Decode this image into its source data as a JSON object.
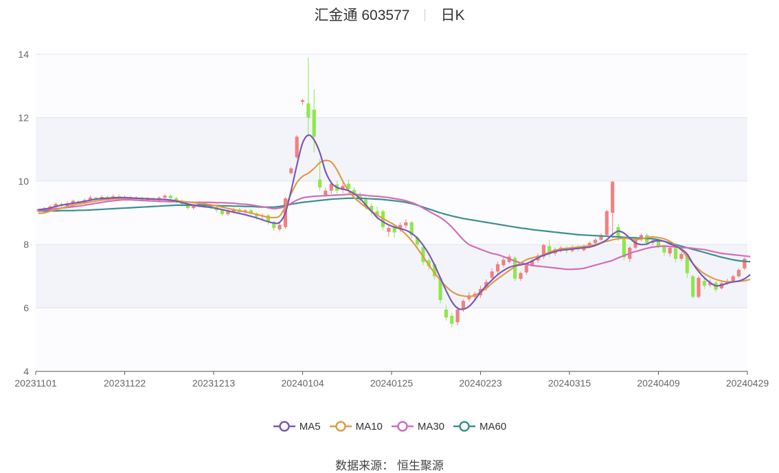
{
  "header": {
    "stock": "汇金通 603577",
    "period": "日K"
  },
  "source": {
    "label": "数据来源：",
    "value": "恒生聚源"
  },
  "colors": {
    "up": "#f28080",
    "down": "#8ee84a",
    "ma5": "#7a57b8",
    "ma10": "#e29a46",
    "ma30": "#d56bb9",
    "ma60": "#3a8f8d",
    "band": "#f2f4fa",
    "grid": "#dde3ee"
  },
  "legend": [
    {
      "key": "ma5",
      "label": "MA5"
    },
    {
      "key": "ma10",
      "label": "MA10"
    },
    {
      "key": "ma30",
      "label": "MA30"
    },
    {
      "key": "ma60",
      "label": "MA60"
    }
  ],
  "chart_data": {
    "type": "candlestick",
    "ylim": [
      4,
      14
    ],
    "yticks": [
      4,
      6,
      8,
      10,
      12,
      14
    ],
    "xticks": [
      "20231101",
      "20231122",
      "20231213",
      "20240104",
      "20240125",
      "20240223",
      "20240315",
      "20240409",
      "20240429"
    ],
    "grid": true,
    "legend_position": "bottom",
    "ohlc": [
      [
        9.05,
        9.12,
        8.98,
        9.14
      ],
      [
        9.08,
        9.15,
        9.02,
        9.18
      ],
      [
        9.12,
        9.2,
        9.08,
        9.24
      ],
      [
        9.18,
        9.28,
        9.12,
        9.32
      ],
      [
        9.28,
        9.22,
        9.16,
        9.34
      ],
      [
        9.22,
        9.3,
        9.18,
        9.36
      ],
      [
        9.3,
        9.38,
        9.25,
        9.42
      ],
      [
        9.36,
        9.32,
        9.27,
        9.4
      ],
      [
        9.32,
        9.4,
        9.28,
        9.45
      ],
      [
        9.4,
        9.48,
        9.35,
        9.55
      ],
      [
        9.48,
        9.42,
        9.36,
        9.52
      ],
      [
        9.42,
        9.5,
        9.38,
        9.56
      ],
      [
        9.5,
        9.46,
        9.4,
        9.55
      ],
      [
        9.46,
        9.52,
        9.42,
        9.58
      ],
      [
        9.52,
        9.45,
        9.4,
        9.58
      ],
      [
        9.45,
        9.5,
        9.4,
        9.54
      ],
      [
        9.5,
        9.44,
        9.38,
        9.55
      ],
      [
        9.44,
        9.48,
        9.38,
        9.52
      ],
      [
        9.48,
        9.4,
        9.35,
        9.52
      ],
      [
        9.4,
        9.46,
        9.36,
        9.5
      ],
      [
        9.46,
        9.42,
        9.34,
        9.5
      ],
      [
        9.42,
        9.48,
        9.38,
        9.52
      ],
      [
        9.48,
        9.54,
        9.44,
        9.6
      ],
      [
        9.54,
        9.46,
        9.4,
        9.58
      ],
      [
        9.46,
        9.36,
        9.3,
        9.5
      ],
      [
        9.36,
        9.28,
        9.2,
        9.42
      ],
      [
        9.28,
        9.15,
        9.1,
        9.32
      ],
      [
        9.15,
        9.22,
        9.1,
        9.28
      ],
      [
        9.22,
        9.3,
        9.18,
        9.36
      ],
      [
        9.3,
        9.22,
        9.15,
        9.35
      ],
      [
        9.22,
        9.18,
        9.1,
        9.28
      ],
      [
        9.18,
        9.08,
        9.0,
        9.22
      ],
      [
        9.08,
        8.96,
        8.9,
        9.12
      ],
      [
        8.96,
        9.04,
        8.9,
        9.1
      ],
      [
        9.04,
        9.1,
        8.98,
        9.16
      ],
      [
        9.1,
        9.02,
        8.95,
        9.15
      ],
      [
        9.02,
        9.08,
        8.96,
        9.12
      ],
      [
        9.08,
        8.98,
        8.92,
        9.12
      ],
      [
        8.98,
        8.88,
        8.78,
        9.02
      ],
      [
        8.88,
        8.92,
        8.8,
        8.98
      ],
      [
        8.92,
        8.7,
        8.62,
        8.96
      ],
      [
        8.7,
        8.52,
        8.44,
        8.76
      ],
      [
        8.48,
        8.62,
        8.42,
        8.68
      ],
      [
        8.55,
        9.45,
        8.5,
        9.5
      ],
      [
        10.25,
        10.4,
        10.2,
        10.45
      ],
      [
        10.75,
        11.4,
        10.7,
        11.45
      ],
      [
        12.5,
        12.55,
        12.4,
        12.6
      ],
      [
        12.45,
        12.0,
        11.4,
        13.9
      ],
      [
        12.25,
        11.4,
        10.9,
        12.9
      ],
      [
        10.05,
        9.8,
        9.7,
        10.7
      ],
      [
        9.55,
        9.7,
        9.5,
        9.8
      ],
      [
        9.7,
        9.92,
        9.6,
        10.0
      ],
      [
        9.9,
        9.7,
        9.6,
        10.0
      ],
      [
        9.72,
        9.85,
        9.62,
        9.95
      ],
      [
        9.92,
        9.75,
        9.6,
        10.05
      ],
      [
        9.72,
        9.58,
        9.5,
        9.8
      ],
      [
        9.58,
        9.4,
        9.32,
        9.65
      ],
      [
        9.42,
        9.2,
        9.1,
        9.5
      ],
      [
        9.22,
        9.05,
        8.92,
        9.3
      ],
      [
        9.05,
        8.95,
        8.8,
        9.2
      ],
      [
        9.05,
        8.55,
        8.45,
        9.1
      ],
      [
        8.4,
        8.52,
        8.25,
        8.58
      ],
      [
        8.55,
        8.38,
        8.22,
        8.6
      ],
      [
        8.5,
        8.62,
        8.4,
        8.7
      ],
      [
        8.6,
        8.7,
        8.5,
        8.8
      ],
      [
        8.7,
        8.3,
        8.2,
        8.75
      ],
      [
        8.22,
        8.0,
        7.9,
        8.28
      ],
      [
        7.92,
        7.45,
        7.35,
        8.0
      ],
      [
        7.5,
        7.32,
        7.2,
        7.58
      ],
      [
        7.38,
        7.0,
        6.9,
        7.42
      ],
      [
        6.95,
        6.25,
        6.15,
        7.0
      ],
      [
        5.95,
        5.7,
        5.6,
        6.1
      ],
      [
        5.75,
        5.5,
        5.4,
        5.85
      ],
      [
        5.55,
        5.95,
        5.45,
        6.05
      ],
      [
        5.95,
        6.22,
        5.88,
        6.28
      ],
      [
        6.28,
        6.4,
        6.2,
        6.5
      ],
      [
        6.35,
        6.45,
        6.28,
        6.52
      ],
      [
        6.4,
        6.6,
        6.32,
        6.7
      ],
      [
        6.62,
        6.82,
        6.55,
        6.9
      ],
      [
        6.95,
        7.15,
        6.88,
        7.25
      ],
      [
        7.15,
        7.38,
        7.05,
        7.45
      ],
      [
        7.35,
        7.52,
        7.28,
        7.6
      ],
      [
        7.45,
        7.62,
        7.4,
        7.7
      ],
      [
        7.58,
        6.92,
        6.85,
        7.65
      ],
      [
        6.92,
        7.1,
        6.85,
        7.15
      ],
      [
        7.12,
        7.35,
        7.05,
        7.4
      ],
      [
        7.35,
        7.5,
        7.3,
        7.55
      ],
      [
        7.5,
        7.65,
        7.42,
        7.72
      ],
      [
        7.62,
        7.98,
        7.55,
        8.02
      ],
      [
        7.95,
        7.72,
        7.6,
        8.15
      ],
      [
        7.72,
        7.85,
        7.65,
        7.9
      ],
      [
        7.82,
        7.9,
        7.75,
        7.95
      ],
      [
        7.88,
        7.8,
        7.72,
        7.95
      ],
      [
        7.8,
        7.92,
        7.75,
        7.98
      ],
      [
        7.92,
        7.85,
        7.78,
        7.98
      ],
      [
        7.82,
        7.95,
        7.78,
        8.0
      ],
      [
        7.95,
        8.05,
        7.88,
        8.1
      ],
      [
        8.05,
        8.15,
        8.0,
        8.2
      ],
      [
        8.15,
        8.3,
        8.1,
        8.35
      ],
      [
        8.3,
        9.05,
        8.25,
        9.1
      ],
      [
        9.0,
        9.98,
        8.2,
        10.0
      ],
      [
        8.55,
        8.25,
        8.1,
        8.65
      ],
      [
        8.2,
        7.6,
        7.5,
        8.25
      ],
      [
        7.55,
        7.9,
        7.45,
        7.95
      ],
      [
        7.9,
        8.15,
        7.85,
        8.25
      ],
      [
        8.15,
        8.3,
        8.1,
        8.35
      ],
      [
        8.3,
        8.05,
        7.95,
        8.35
      ],
      [
        8.05,
        8.12,
        7.98,
        8.18
      ],
      [
        8.12,
        7.95,
        7.88,
        8.15
      ],
      [
        7.95,
        7.75,
        7.65,
        8.0
      ],
      [
        7.72,
        7.9,
        7.62,
        7.95
      ],
      [
        7.88,
        7.55,
        7.45,
        7.92
      ],
      [
        7.55,
        7.7,
        7.48,
        7.75
      ],
      [
        7.68,
        7.1,
        6.95,
        7.72
      ],
      [
        7.0,
        6.35,
        6.3,
        7.05
      ],
      [
        6.35,
        6.95,
        6.3,
        7.0
      ],
      [
        6.85,
        6.7,
        6.6,
        7.0
      ],
      [
        6.72,
        6.8,
        6.65,
        6.9
      ],
      [
        6.8,
        6.58,
        6.5,
        6.85
      ],
      [
        6.62,
        6.78,
        6.58,
        6.85
      ],
      [
        6.78,
        6.85,
        6.72,
        6.92
      ],
      [
        6.85,
        7.0,
        6.8,
        7.05
      ],
      [
        7.0,
        7.2,
        6.95,
        7.25
      ],
      [
        7.25,
        7.55,
        7.2,
        7.6
      ]
    ],
    "series": [
      {
        "name": "MA5",
        "values": [
          9.1,
          9.12,
          9.15,
          9.2,
          9.24,
          9.27,
          9.3,
          9.33,
          9.36,
          9.4,
          9.43,
          9.45,
          9.46,
          9.47,
          9.48,
          9.48,
          9.47,
          9.46,
          9.45,
          9.44,
          9.43,
          9.42,
          9.42,
          9.4,
          9.37,
          9.32,
          9.28,
          9.24,
          9.21,
          9.19,
          9.17,
          9.14,
          9.1,
          9.06,
          9.02,
          8.98,
          8.94,
          8.89,
          8.84,
          8.78,
          8.72,
          8.68,
          8.7,
          9.0,
          9.7,
          10.5,
          11.2,
          11.45,
          11.3,
          10.9,
          10.3,
          9.95,
          9.8,
          9.75,
          9.7,
          9.6,
          9.45,
          9.25,
          9.05,
          8.85,
          8.72,
          8.62,
          8.55,
          8.5,
          8.45,
          8.35,
          8.2,
          7.98,
          7.7,
          7.35,
          6.95,
          6.55,
          6.2,
          5.99,
          5.96,
          6.05,
          6.25,
          6.5,
          6.7,
          6.88,
          7.05,
          7.18,
          7.28,
          7.33,
          7.36,
          7.4,
          7.48,
          7.58,
          7.66,
          7.72,
          7.78,
          7.82,
          7.84,
          7.86,
          7.88,
          7.9,
          7.92,
          7.97,
          8.05,
          8.15,
          8.32,
          8.42,
          8.36,
          8.2,
          8.05,
          8.0,
          8.02,
          8.1,
          8.12,
          8.1,
          8.02,
          7.95,
          7.85,
          7.7,
          7.4,
          7.15,
          6.95,
          6.8,
          6.7,
          6.72,
          6.78,
          6.82,
          6.85,
          6.92,
          7.05
        ]
      },
      {
        "name": "MA10",
        "values": [
          8.98,
          9.0,
          9.05,
          9.1,
          9.15,
          9.2,
          9.24,
          9.28,
          9.31,
          9.34,
          9.37,
          9.4,
          9.42,
          9.44,
          9.45,
          9.46,
          9.46,
          9.46,
          9.45,
          9.45,
          9.44,
          9.43,
          9.42,
          9.4,
          9.38,
          9.36,
          9.34,
          9.32,
          9.3,
          9.28,
          9.25,
          9.22,
          9.18,
          9.14,
          9.1,
          9.06,
          9.03,
          8.99,
          8.95,
          8.9,
          8.86,
          8.85,
          8.9,
          9.2,
          9.6,
          9.95,
          10.15,
          10.25,
          10.4,
          10.58,
          10.65,
          10.6,
          10.35,
          10.0,
          9.7,
          9.48,
          9.32,
          9.18,
          9.05,
          8.93,
          8.82,
          8.72,
          8.62,
          8.48,
          8.32,
          8.12,
          7.88,
          7.62,
          7.35,
          7.1,
          6.88,
          6.68,
          6.52,
          6.42,
          6.38,
          6.36,
          6.4,
          6.5,
          6.62,
          6.78,
          6.92,
          7.05,
          7.18,
          7.3,
          7.42,
          7.52,
          7.58,
          7.62,
          7.68,
          7.76,
          7.82,
          7.86,
          7.88,
          7.9,
          7.92,
          7.94,
          7.96,
          8.0,
          8.05,
          8.1,
          8.15,
          8.18,
          8.2,
          8.18,
          8.15,
          8.18,
          8.22,
          8.24,
          8.22,
          8.18,
          8.1,
          7.98,
          7.82,
          7.62,
          7.4,
          7.22,
          7.08,
          6.98,
          6.9,
          6.85,
          6.82,
          6.83,
          6.84,
          6.86,
          6.9
        ]
      },
      {
        "name": "MA30",
        "values": [
          9.08,
          9.09,
          9.11,
          9.13,
          9.15,
          9.17,
          9.19,
          9.21,
          9.24,
          9.27,
          9.3,
          9.33,
          9.36,
          9.38,
          9.4,
          9.41,
          9.41,
          9.4,
          9.39,
          9.38,
          9.37,
          9.36,
          9.36,
          9.35,
          9.35,
          9.34,
          9.34,
          9.33,
          9.33,
          9.33,
          9.33,
          9.32,
          9.32,
          9.31,
          9.3,
          9.28,
          9.27,
          9.25,
          9.22,
          9.19,
          9.16,
          9.13,
          9.15,
          9.2,
          9.3,
          9.4,
          9.47,
          9.5,
          9.52,
          9.53,
          9.54,
          9.55,
          9.56,
          9.57,
          9.58,
          9.58,
          9.57,
          9.55,
          9.53,
          9.52,
          9.5,
          9.48,
          9.45,
          9.42,
          9.38,
          9.32,
          9.25,
          9.15,
          9.05,
          8.95,
          8.85,
          8.72,
          8.55,
          8.35,
          8.15,
          8.0,
          7.92,
          7.85,
          7.78,
          7.72,
          7.68,
          7.62,
          7.55,
          7.48,
          7.42,
          7.38,
          7.34,
          7.32,
          7.3,
          7.28,
          7.26,
          7.24,
          7.22,
          7.22,
          7.23,
          7.25,
          7.3,
          7.35,
          7.4,
          7.45,
          7.5,
          7.58,
          7.65,
          7.72,
          7.78,
          7.83,
          7.88,
          7.92,
          7.94,
          7.95,
          7.94,
          7.92,
          7.9,
          7.9,
          7.88,
          7.86,
          7.84,
          7.8,
          7.76,
          7.72,
          7.7,
          7.68,
          7.66,
          7.64,
          7.62
        ]
      },
      {
        "name": "MA60",
        "values": [
          9.06,
          9.06,
          9.06,
          9.06,
          9.07,
          9.07,
          9.07,
          9.08,
          9.08,
          9.09,
          9.1,
          9.11,
          9.12,
          9.13,
          9.14,
          9.15,
          9.16,
          9.17,
          9.18,
          9.19,
          9.2,
          9.21,
          9.22,
          9.23,
          9.24,
          9.24,
          9.24,
          9.24,
          9.24,
          9.24,
          9.23,
          9.23,
          9.22,
          9.22,
          9.21,
          9.21,
          9.2,
          9.2,
          9.19,
          9.18,
          9.18,
          9.18,
          9.2,
          9.23,
          9.27,
          9.3,
          9.33,
          9.35,
          9.37,
          9.39,
          9.41,
          9.43,
          9.44,
          9.45,
          9.46,
          9.46,
          9.46,
          9.45,
          9.44,
          9.43,
          9.42,
          9.4,
          9.38,
          9.36,
          9.33,
          9.29,
          9.24,
          9.18,
          9.12,
          9.06,
          9.0,
          8.95,
          8.9,
          8.86,
          8.82,
          8.79,
          8.76,
          8.73,
          8.7,
          8.67,
          8.64,
          8.61,
          8.58,
          8.55,
          8.52,
          8.5,
          8.47,
          8.45,
          8.43,
          8.41,
          8.39,
          8.37,
          8.35,
          8.33,
          8.31,
          8.3,
          8.29,
          8.28,
          8.27,
          8.26,
          8.25,
          8.24,
          8.23,
          8.22,
          8.21,
          8.2,
          8.19,
          8.18,
          8.15,
          8.1,
          8.05,
          8.0,
          7.95,
          7.9,
          7.85,
          7.8,
          7.75,
          7.7,
          7.65,
          7.6,
          7.56,
          7.52,
          7.49,
          7.47,
          7.46
        ]
      }
    ]
  }
}
